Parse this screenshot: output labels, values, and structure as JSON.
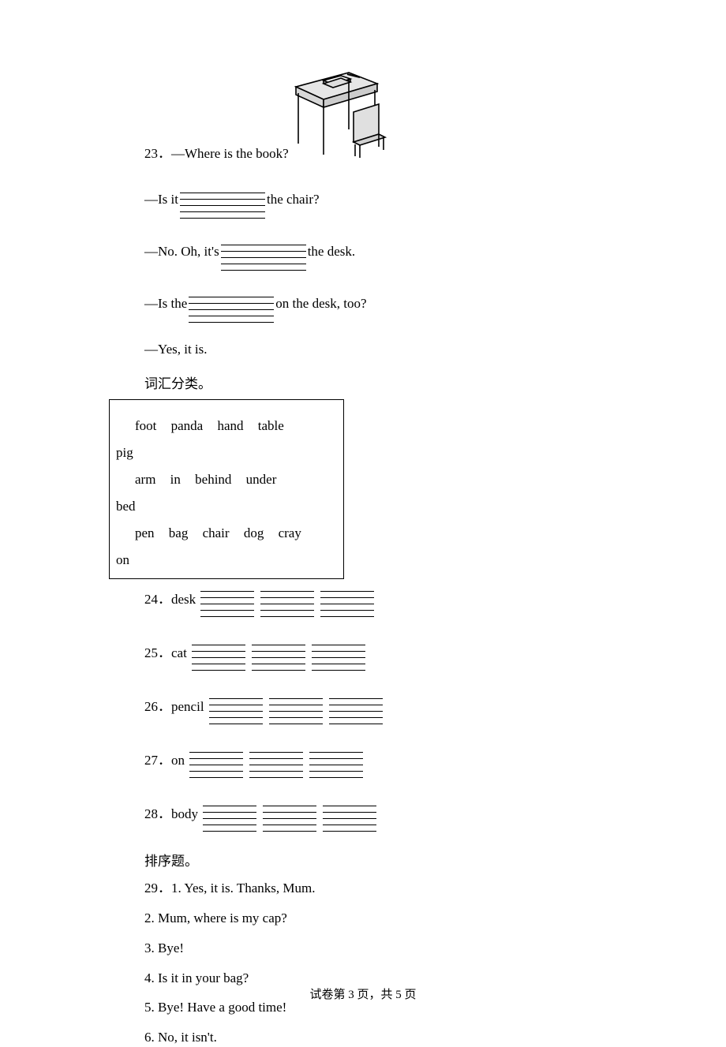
{
  "q23": {
    "number": "23．",
    "prompt": "—Where is the book?",
    "line_isit_pre": "—Is it ",
    "line_isit_post": " the chair?",
    "line_no_pre": "—No. Oh, it's ",
    "line_no_post": " the desk.",
    "line_isthe_pre": "—Is the ",
    "line_isthe_post": " on the desk, too?",
    "line_yes": "—Yes, it is."
  },
  "vocab_section_title": "词汇分类。",
  "wordbox": {
    "l1a": "foot     panda     hand     table",
    "l1b": "pig",
    "l2a": "arm     in     behind     under",
    "l2b": "bed",
    "l3a": "pen    bag    chair    dog    cray",
    "l3b": "on"
  },
  "items": {
    "i24": "24．desk",
    "i25": "25．cat",
    "i26": "26．pencil",
    "i27": "27．on",
    "i28": "28．body"
  },
  "order_section_title": "排序题。",
  "q29": {
    "header": "29．1. Yes, it is. Thanks, Mum.",
    "l2": "2. Mum, where is my cap?",
    "l3": "3. Bye!",
    "l4": "4. Is it in your bag?",
    "l5": "5. Bye! Have a good time!",
    "l6": "6. No, it isn't."
  },
  "footer": "试卷第 3 页，共 5 页"
}
